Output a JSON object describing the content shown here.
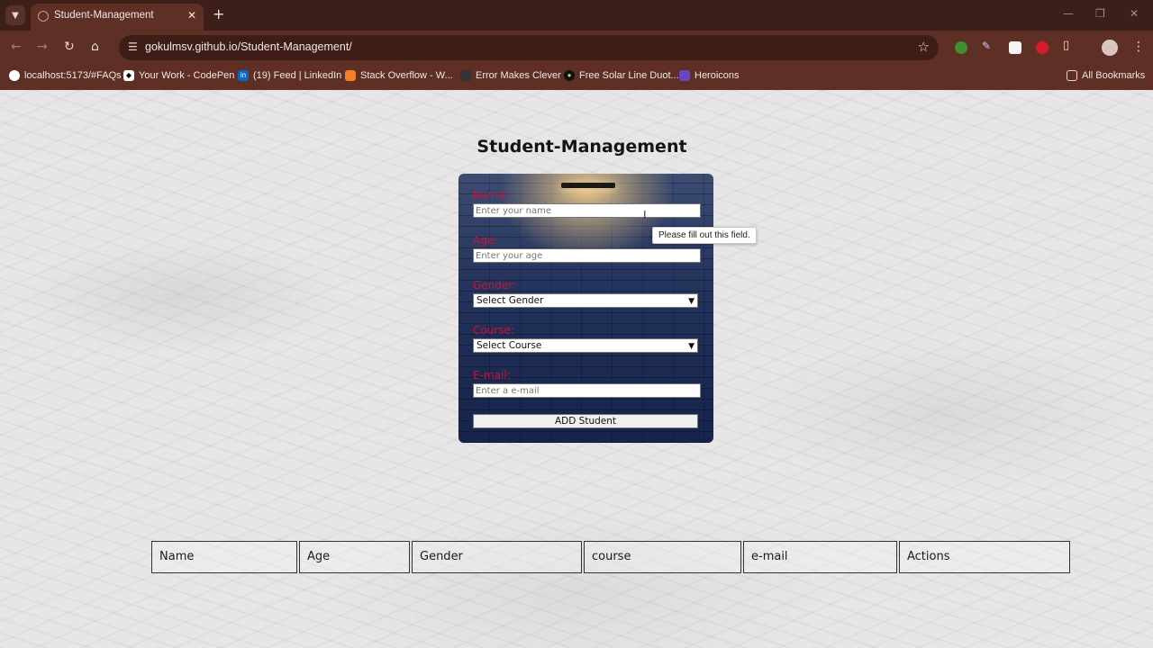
{
  "browser": {
    "tab_title": "Student-Management",
    "url": "gokulmsv.github.io/Student-Management/",
    "bookmarks": [
      "localhost:5173/#FAQs",
      "Your Work - CodePen",
      "(19) Feed | LinkedIn",
      "Stack Overflow - W...",
      "Error Makes Clever",
      "Free Solar Line Duot...",
      "Heroicons"
    ],
    "all_bookmarks": "All Bookmarks"
  },
  "page": {
    "title": "Student-Management",
    "form": {
      "name_label": "Name:",
      "name_placeholder": "Enter your name",
      "age_label": "Age:",
      "age_placeholder": "Enter your age",
      "gender_label": "Gender:",
      "gender_selected": "Select Gender",
      "course_label": "Course:",
      "course_selected": "Select Course",
      "email_label": "E-mail:",
      "email_placeholder": "Enter a e-mail",
      "submit_label": "ADD Student"
    },
    "validation_tooltip": "Please fill out this field.",
    "table": {
      "headers": [
        "Name",
        "Age",
        "Gender",
        "course",
        "e-mail",
        "Actions"
      ]
    }
  },
  "colors": {
    "label_red": "#c2183a",
    "card_navy": "#16234a"
  }
}
